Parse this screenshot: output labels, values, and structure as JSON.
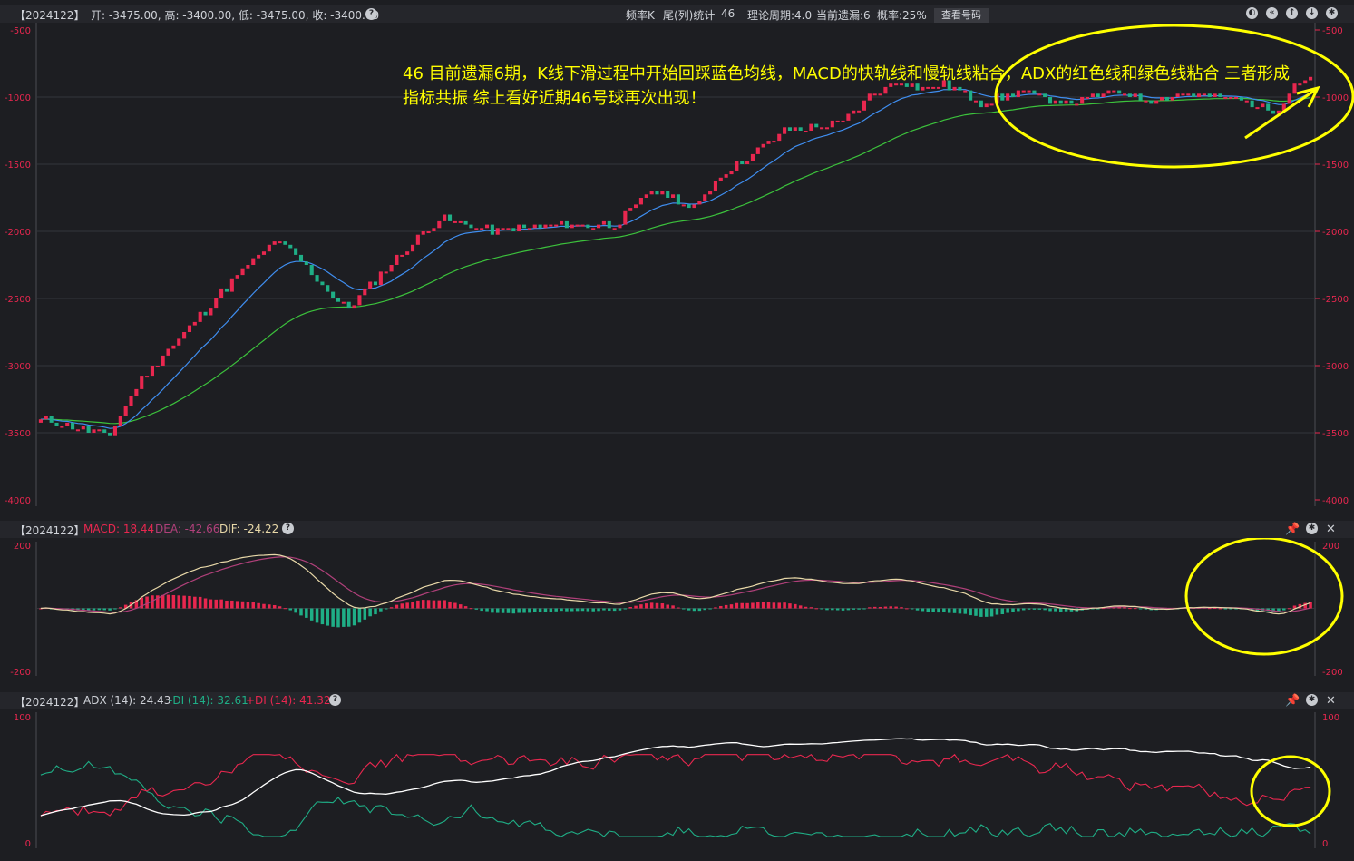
{
  "header": {
    "period": "【2024122】",
    "ohlc": "开: -3475.00, 高: -3400.00, 低: -3475.00, 收: -3400.00",
    "freq": "频率K",
    "stat": "尾(列)统计",
    "number": "46",
    "theory": "理论周期:4.0",
    "current": "当前遗漏:6",
    "prob": "概率:25%",
    "view_button": "查看号码"
  },
  "annotation": {
    "line1": "46 目前遗漏6期，K线下滑过程中开始回踩蓝色均线，MACD的快轨线和慢轨线粘合，ADX的红色线和绿色线粘合 三者形成",
    "line2": "指标共振 综上看好近期46号球再次出现！"
  },
  "macd_header": {
    "period": "【2024122】",
    "macd": "MACD: 18.44",
    "dea": "DEA: -42.66",
    "dif": "DIF: -24.22"
  },
  "adx_header": {
    "period": "【2024122】",
    "adx": "ADX (14): 24.43",
    "mdi": "-DI (14): 32.61",
    "pdi": "+DI (14): 41.32"
  },
  "colors": {
    "background": "#1d1e22",
    "up": "#e8274f",
    "down": "#1fae86",
    "ma_fast": "#3f8ef0",
    "ma_slow": "#3cc23c",
    "annotation": "#ffff00",
    "dif": "#e8d8a8",
    "dea": "#b0407a",
    "adx": "#ffffff",
    "pdi": "#e8274f",
    "mdi": "#1fae86"
  },
  "icons": {
    "header_tools": [
      "compass-icon",
      "back-icon",
      "up-icon",
      "down-icon",
      "settings-icon"
    ],
    "panel_tools": [
      "pin-icon",
      "settings-icon",
      "close-icon"
    ],
    "help": "help-icon"
  },
  "chart_data": [
    {
      "type": "candlestick",
      "title": "",
      "ylim": [
        -4000,
        -500
      ],
      "yticks": [
        "-500",
        "-1000",
        "-1500",
        "-2000",
        "-2500",
        "-3000",
        "-3500",
        "-4000"
      ],
      "candle_count": 240,
      "waypoints": [
        [
          0,
          -3400
        ],
        [
          14,
          -3500
        ],
        [
          16,
          -3550
        ],
        [
          24,
          -3100
        ],
        [
          48,
          -2300
        ],
        [
          56,
          -2070
        ],
        [
          60,
          -2150
        ],
        [
          72,
          -2550
        ],
        [
          74,
          -2570
        ],
        [
          82,
          -2300
        ],
        [
          92,
          -2000
        ],
        [
          96,
          -1900
        ],
        [
          108,
          -2000
        ],
        [
          124,
          -1950
        ],
        [
          138,
          -1950
        ],
        [
          146,
          -1700
        ],
        [
          152,
          -1750
        ],
        [
          156,
          -1850
        ],
        [
          162,
          -1600
        ],
        [
          174,
          -1350
        ],
        [
          178,
          -1250
        ],
        [
          192,
          -1200
        ],
        [
          198,
          -1000
        ],
        [
          206,
          -870
        ],
        [
          212,
          -950
        ],
        [
          216,
          -900
        ],
        [
          226,
          -1050
        ],
        [
          234,
          -950
        ],
        [
          246,
          -1050
        ],
        [
          258,
          -950
        ],
        [
          264,
          -1020
        ],
        [
          274,
          -980
        ],
        [
          284,
          -1000
        ],
        [
          296,
          -1100
        ],
        [
          300,
          -900
        ],
        [
          304,
          -850
        ]
      ],
      "series": [
        {
          "name": "",
          "role": "candles"
        },
        {
          "name": "",
          "role": "ma_fast"
        },
        {
          "name": "",
          "role": "ma_slow"
        }
      ],
      "last": {
        "open": -3475,
        "high": -3400,
        "low": -3475,
        "close": -3400
      }
    },
    {
      "type": "line",
      "title": "",
      "ylim": [
        -200,
        200
      ],
      "yticks": [
        "200",
        "-200"
      ],
      "values": {
        "macd": 18.44,
        "dea": -42.66,
        "dif": -24.22
      }
    },
    {
      "type": "line",
      "title": "",
      "ylim": [
        0,
        100
      ],
      "yticks": [
        "100",
        "0"
      ],
      "values": {
        "adx": 24.43,
        "mdi": 32.61,
        "pdi": 41.32
      }
    }
  ]
}
